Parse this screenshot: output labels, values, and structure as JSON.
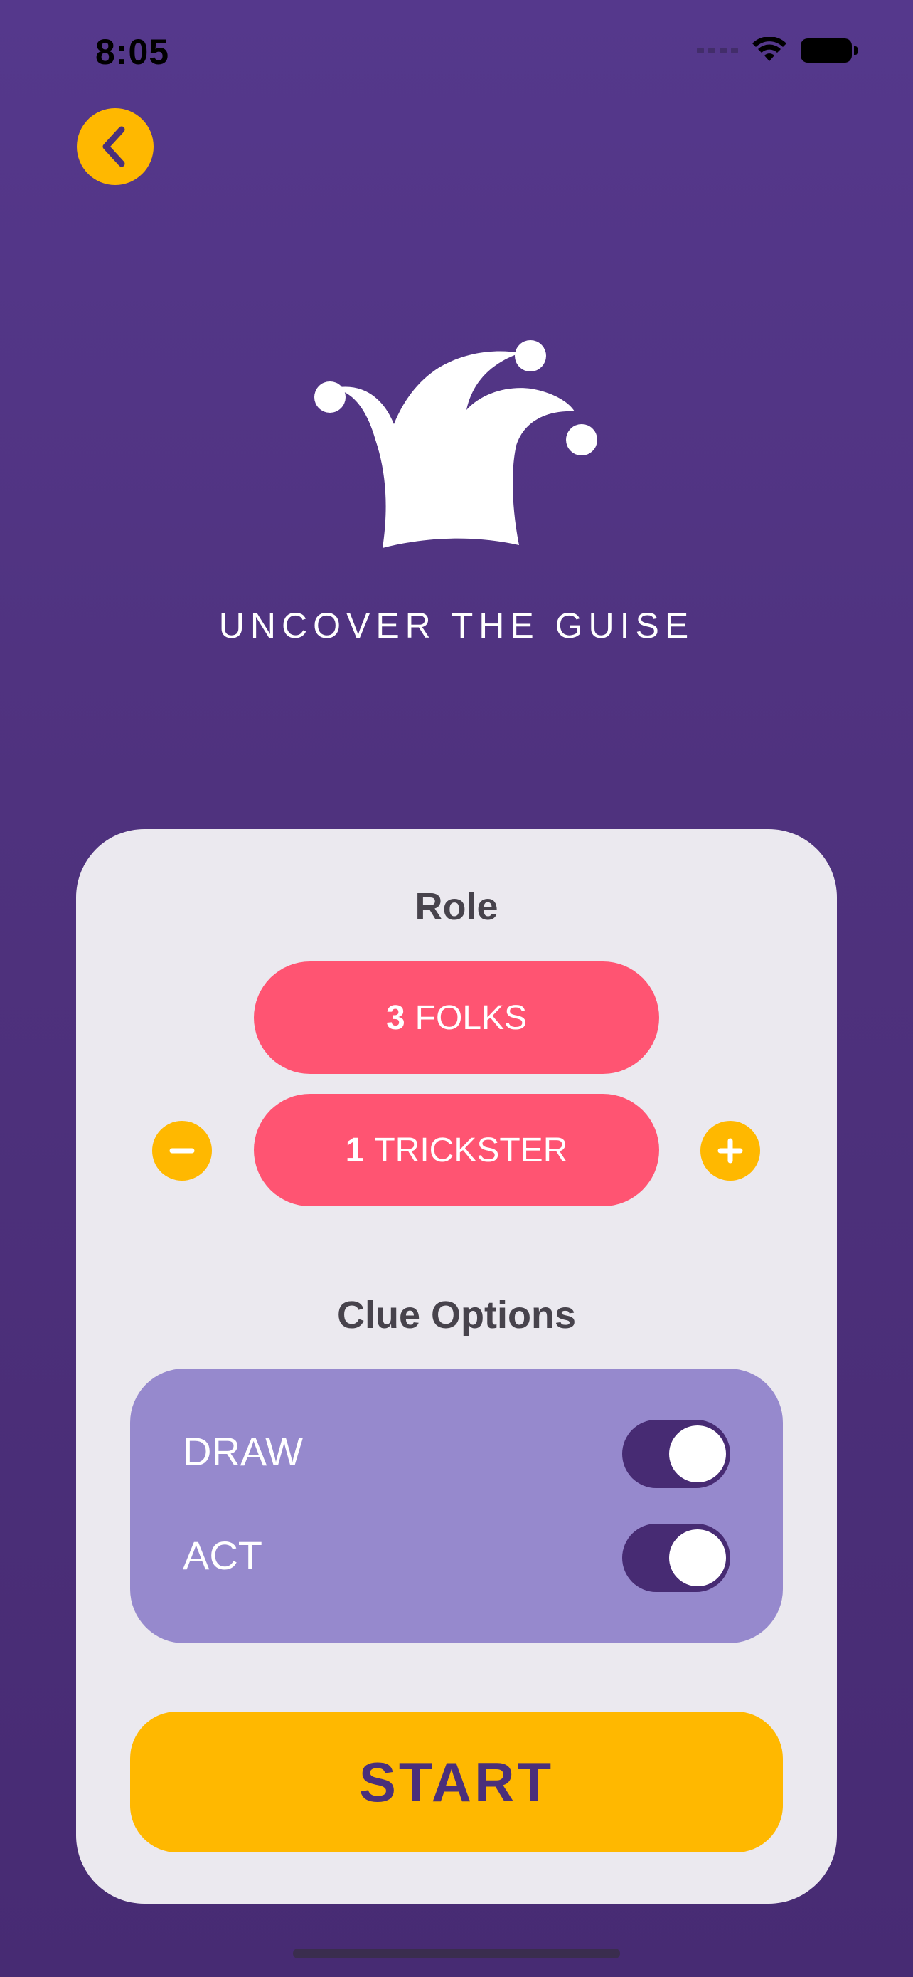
{
  "status_bar": {
    "time": "8:05"
  },
  "header": {
    "tagline": "UNCOVER THE GUISE"
  },
  "card": {
    "role_title": "Role",
    "folks": {
      "count": "3",
      "label": "FOLKS"
    },
    "trickster": {
      "count": "1",
      "label": "TRICKSTER"
    },
    "clue_title": "Clue Options",
    "options": [
      {
        "label": "DRAW",
        "enabled": true
      },
      {
        "label": "ACT",
        "enabled": true
      }
    ],
    "start_label": "START"
  },
  "colors": {
    "background": "#55388c",
    "accent_yellow": "#ffb800",
    "pill_pink": "#ff5472",
    "options_purple": "#9689cd",
    "card_bg": "#ebe9ef"
  },
  "icons": [
    "back-chevron-icon",
    "jester-hat-icon",
    "minus-icon",
    "plus-icon",
    "wifi-icon",
    "battery-icon"
  ]
}
